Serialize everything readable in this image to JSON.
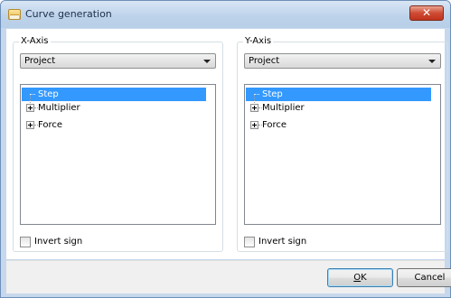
{
  "window": {
    "title": "Curve generation",
    "close_glyph": "✕"
  },
  "x_axis": {
    "label": "X-Axis",
    "source_selected": "Project",
    "tree": [
      {
        "label": "Step",
        "selected": true,
        "expandable": false
      },
      {
        "label": "Multiplier",
        "selected": false,
        "expandable": true
      },
      {
        "label": "Force",
        "selected": false,
        "expandable": true
      }
    ],
    "invert_label": "Invert sign",
    "invert_checked": false
  },
  "y_axis": {
    "label": "Y-Axis",
    "source_selected": "Project",
    "tree": [
      {
        "label": "Step",
        "selected": true,
        "expandable": false
      },
      {
        "label": "Multiplier",
        "selected": false,
        "expandable": true
      },
      {
        "label": "Force",
        "selected": false,
        "expandable": true
      }
    ],
    "invert_label": "Invert sign",
    "invert_checked": false
  },
  "buttons": {
    "ok_mnemonic": "O",
    "ok_rest": "K",
    "cancel": "Cancel"
  },
  "colors": {
    "selection": "#3399ff",
    "titlebar": "#bcd2ea",
    "close": "#c0331d"
  }
}
